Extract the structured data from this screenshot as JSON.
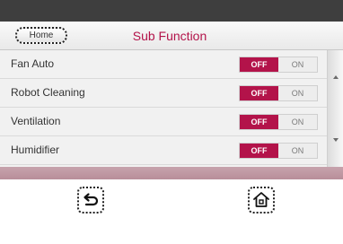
{
  "header": {
    "home_label": "Home",
    "title": "Sub Function"
  },
  "rows": [
    {
      "label": "Fan Auto",
      "state": "OFF",
      "off_label": "OFF",
      "on_label": "ON"
    },
    {
      "label": "Robot Cleaning",
      "state": "OFF",
      "off_label": "OFF",
      "on_label": "ON"
    },
    {
      "label": "Ventilation",
      "state": "OFF",
      "off_label": "OFF",
      "on_label": "ON"
    },
    {
      "label": "Humidifier",
      "state": "OFF",
      "off_label": "OFF",
      "on_label": "ON"
    }
  ],
  "icons": {
    "back": "back-arrow-icon",
    "home": "home-icon"
  },
  "colors": {
    "accent": "#b3134a",
    "topbar": "#3e3e3e",
    "content_bg": "#f1f1f1"
  }
}
